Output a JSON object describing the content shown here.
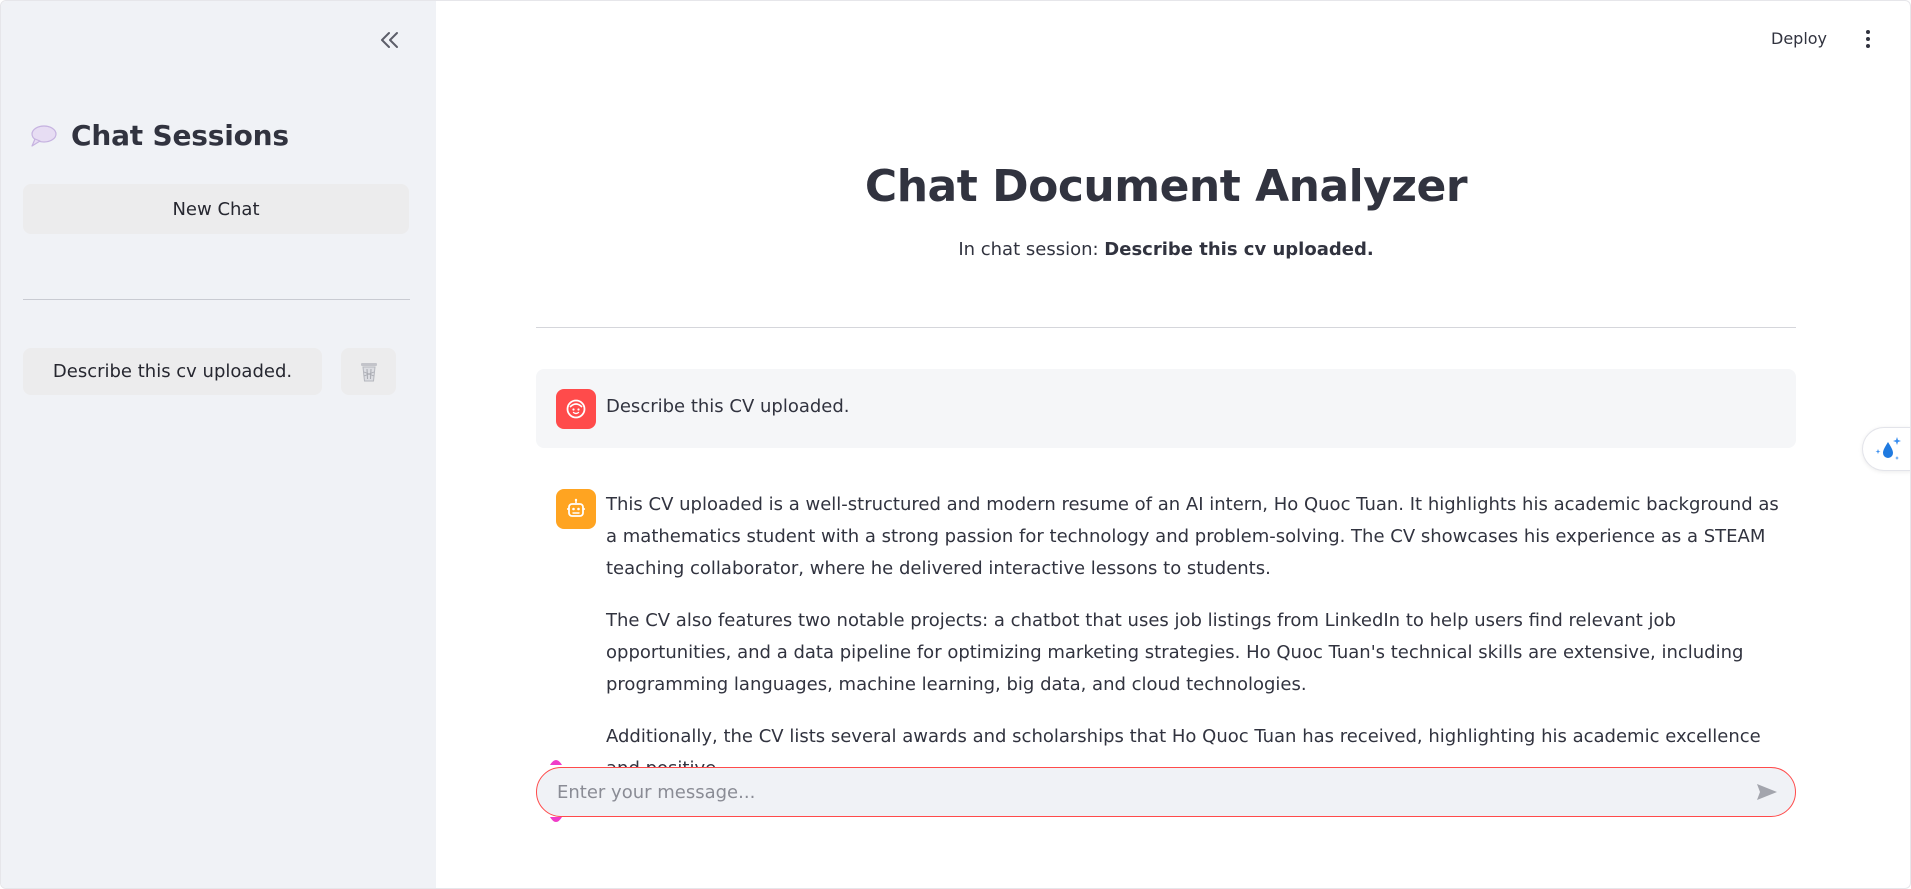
{
  "sidebar": {
    "collapse_icon": "double-chevron-left-icon",
    "title_icon": "speech-balloon-icon",
    "title": "Chat Sessions",
    "new_chat_label": "New Chat",
    "sessions": [
      {
        "label": "Describe this cv uploaded.",
        "delete_icon": "trash-icon"
      }
    ]
  },
  "header": {
    "deploy_label": "Deploy",
    "menu_icon": "kebab-menu-icon"
  },
  "main": {
    "title": "Chat Document Analyzer",
    "session_prefix": "In chat session:",
    "session_name": "Describe this cv uploaded."
  },
  "messages": [
    {
      "role": "user",
      "avatar_icon": "user-face-icon",
      "text": "Describe this CV uploaded."
    },
    {
      "role": "assistant",
      "avatar_icon": "robot-icon",
      "paragraphs": [
        "This CV uploaded is a well-structured and modern resume of an AI intern, Ho Quoc Tuan. It highlights his academic background as a mathematics student with a strong passion for technology and problem-solving. The CV showcases his experience as a STEAM teaching collaborator, where he delivered interactive lessons to students.",
        "The CV also features two notable projects: a chatbot that uses job listings from LinkedIn to help users find relevant job opportunities, and a data pipeline for optimizing marketing strategies. Ho Quoc Tuan's technical skills are extensive, including programming languages, machine learning, big data, and cloud technologies.",
        "Additionally, the CV lists several awards and scholarships that Ho Quoc Tuan has received, highlighting his academic excellence and positive"
      ]
    }
  ],
  "composer": {
    "placeholder": "Enter your message...",
    "value": "",
    "send_icon": "send-arrow-icon"
  },
  "floating": {
    "icon": "water-drop-sparkle-icon"
  },
  "colors": {
    "sidebar_bg": "#f0f2f6",
    "accent_red": "#ff4b4b",
    "bot_orange": "#ffa421",
    "text": "#31333f"
  }
}
